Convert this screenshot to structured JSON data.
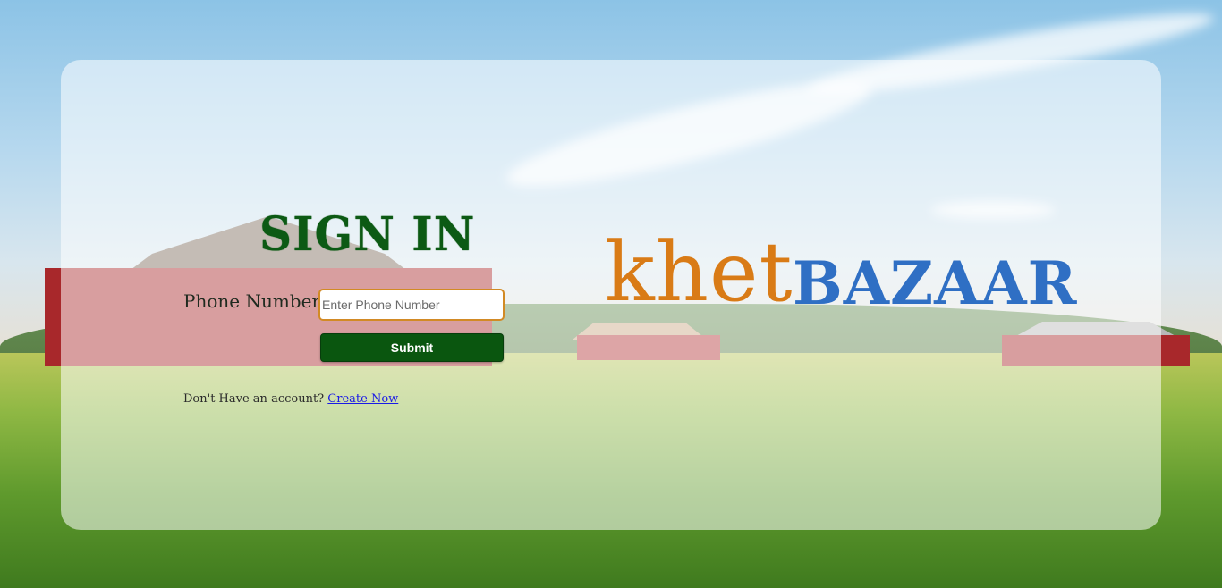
{
  "signin": {
    "title": "SIGN IN",
    "phone_label": "Phone Number:",
    "phone_placeholder": "Enter Phone Number",
    "phone_value": "",
    "submit_label": "Submit",
    "account_prompt": "Don't Have an account?",
    "create_link": "Create Now"
  },
  "brand": {
    "part1": "khet",
    "part2": "BAZAAR",
    "part1_color": "#d97b16",
    "part2_color": "#2f6fc4"
  },
  "colors": {
    "title": "#0c5a14",
    "submit_bg": "#0a560f",
    "input_border": "#d28a25",
    "link": "#1a1ae6"
  },
  "background": {
    "icon": "farm-barn-field-scene"
  }
}
